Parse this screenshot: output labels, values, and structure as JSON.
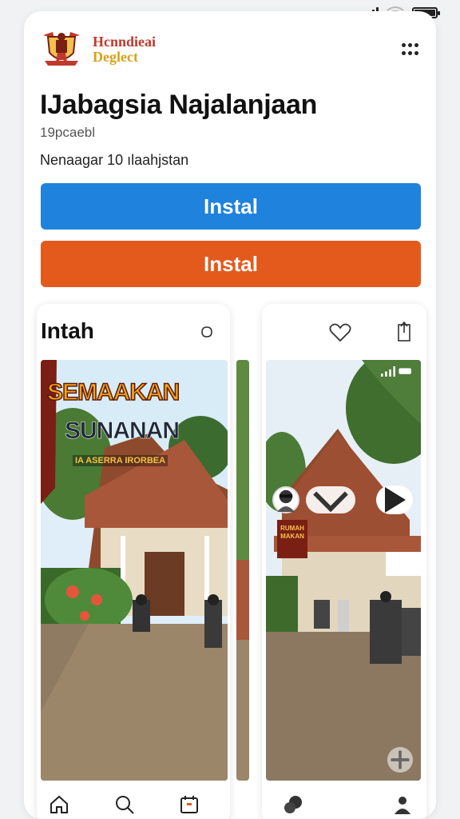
{
  "status": {
    "signal": "signal-icon",
    "wifi": "wifi-icon",
    "battery": "battery-icon"
  },
  "header": {
    "brand_line1": "Hcnndieai",
    "brand_line2": "Deglect",
    "menu_icon": "more-icon"
  },
  "app": {
    "title": "IJabagsia Najalanjaan",
    "subtitle": "19pcaebl",
    "description": "Nenaagar 10 ılaahjstan"
  },
  "buttons": {
    "install_primary": "Instal",
    "install_secondary": "Instal"
  },
  "colors": {
    "primary_button": "#1f82dc",
    "secondary_button": "#e35a1c"
  },
  "gallery": {
    "label": "Intah",
    "left_image_texts": {
      "line1": "SEMAAKAN",
      "line2": "SUNANAN",
      "line3": "IA ASERRA IRORBEA"
    },
    "right_sign_text": "RUMAH MAKAN"
  },
  "bottom_nav": [
    "home-icon",
    "search-icon",
    "calendar-icon",
    "chat-icon",
    "profile-icon"
  ]
}
